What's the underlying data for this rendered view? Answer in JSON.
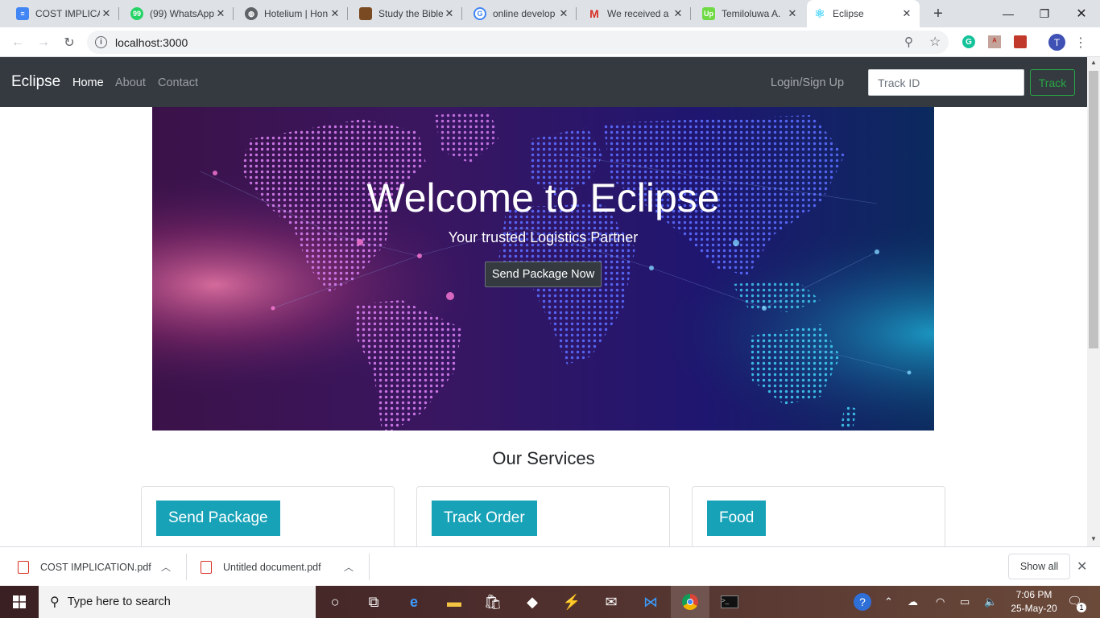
{
  "browser": {
    "tabs": [
      {
        "title": "COST IMPLICATI",
        "icon": "docs-icon",
        "color": "#4285f4"
      },
      {
        "title": "(99) WhatsApp",
        "icon": "whatsapp-icon",
        "color": "#25d366",
        "badge": "99"
      },
      {
        "title": "Hotelium | Hon",
        "icon": "globe-icon",
        "color": "#5f6368"
      },
      {
        "title": "Study the Bible",
        "icon": "bible-icon",
        "color": "#7a4a22"
      },
      {
        "title": "online develop",
        "icon": "google-icon",
        "color": "#4285f4"
      },
      {
        "title": "We received a",
        "icon": "gmail-icon",
        "color": "#d93025"
      },
      {
        "title": "Temiloluwa A.",
        "icon": "upwork-icon",
        "color": "#6fda44",
        "badge": "Up"
      },
      {
        "title": "Eclipse",
        "icon": "react-icon",
        "color": "#61dafb"
      }
    ],
    "new_tab": "+",
    "url": "localhost:3000",
    "profile_initial": "T"
  },
  "site": {
    "brand": "Eclipse",
    "nav": [
      "Home",
      "About",
      "Contact"
    ],
    "login": "Login/Sign Up",
    "track_placeholder": "Track ID",
    "track_button": "Track",
    "hero": {
      "title": "Welcome to Eclipse",
      "subtitle": "Your trusted Logistics Partner",
      "cta": "Send Package Now"
    },
    "services_title": "Our Services",
    "services": [
      "Send Package",
      "Track Order",
      "Food"
    ],
    "accent": "#17a2b8",
    "navbar_color": "#343a40"
  },
  "downloads": {
    "files": [
      "COST IMPLICATION.pdf",
      "Untitled document.pdf"
    ],
    "show_all": "Show all"
  },
  "taskbar": {
    "search_placeholder": "Type here to search",
    "time": "7:06 PM",
    "date": "25-May-20",
    "notifications": "1"
  }
}
